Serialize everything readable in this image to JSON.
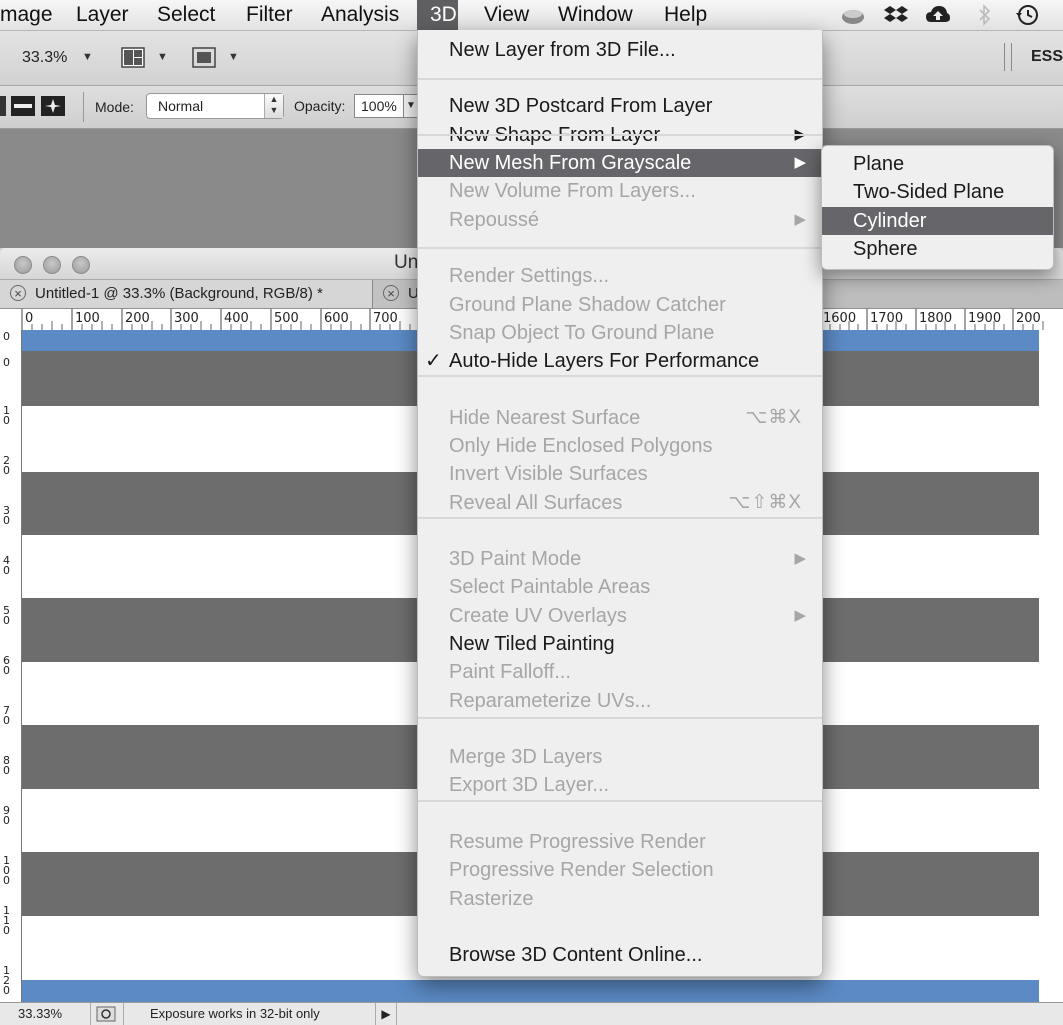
{
  "menubar": {
    "items": [
      "mage",
      "Layer",
      "Select",
      "Filter",
      "Analysis",
      "3D",
      "View",
      "Window",
      "Help"
    ],
    "active": "3D",
    "tray_icons": [
      "cloud-cup-icon",
      "dropbox-icon",
      "cloud-upload-icon",
      "bluetooth-icon",
      "time-machine-icon"
    ]
  },
  "options": {
    "zoom": "33.3%",
    "workspace": "ESSI",
    "mode_label": "Mode:",
    "mode_value": "Normal",
    "opacity_label": "Opacity:",
    "opacity_value": "100%"
  },
  "document": {
    "window_title": "Un",
    "tabs": [
      "Untitled-1 @ 33.3% (Background, RGB/8) *",
      "U"
    ],
    "ruler_h": [
      "0",
      "100",
      "200",
      "300",
      "400",
      "500",
      "600",
      "700",
      "1600",
      "1700",
      "1800",
      "1900",
      "200"
    ],
    "ruler_v": [
      "0",
      "0",
      "10",
      "20",
      "30",
      "40",
      "50",
      "60",
      "70",
      "80",
      "90",
      "100",
      "110",
      "120"
    ],
    "colors": {
      "blue": "#5b8ac4",
      "gray": "#6d6d6d",
      "white": "#ffffff"
    }
  },
  "status": {
    "zoom": "33.33%",
    "message": "Exposure works in 32-bit only"
  },
  "menu3d": {
    "items": [
      {
        "label": "New Layer from 3D File...",
        "enabled": true
      },
      {
        "sep": true
      },
      {
        "label": "New 3D Postcard From Layer",
        "enabled": true
      },
      {
        "label": "New Shape From Layer",
        "enabled": true,
        "submenu": true
      },
      {
        "label": "New Mesh From Grayscale",
        "enabled": true,
        "submenu": true,
        "highlighted": true
      },
      {
        "label": "New Volume From Layers...",
        "enabled": false
      },
      {
        "label": "Repoussé",
        "enabled": false,
        "submenu": true
      },
      {
        "sep": true
      },
      {
        "label": "Render Settings...",
        "enabled": false
      },
      {
        "label": "Ground Plane Shadow Catcher",
        "enabled": false
      },
      {
        "label": "Snap Object To Ground Plane",
        "enabled": false
      },
      {
        "label": "Auto-Hide Layers For Performance",
        "enabled": true,
        "checked": true
      },
      {
        "sep": true
      },
      {
        "label": "Hide Nearest Surface",
        "enabled": false,
        "shortcut": "⌥⌘X"
      },
      {
        "label": "Only Hide Enclosed Polygons",
        "enabled": false
      },
      {
        "label": "Invert Visible Surfaces",
        "enabled": false
      },
      {
        "label": "Reveal All Surfaces",
        "enabled": false,
        "shortcut": "⌥⇧⌘X"
      },
      {
        "sep": true
      },
      {
        "label": "3D Paint Mode",
        "enabled": false,
        "submenu": true
      },
      {
        "label": "Select Paintable Areas",
        "enabled": false
      },
      {
        "label": "Create UV Overlays",
        "enabled": false,
        "submenu": true
      },
      {
        "label": "New Tiled Painting",
        "enabled": true
      },
      {
        "label": "Paint Falloff...",
        "enabled": false
      },
      {
        "label": "Reparameterize UVs...",
        "enabled": false
      },
      {
        "sep": true
      },
      {
        "label": "Merge 3D Layers",
        "enabled": false
      },
      {
        "label": "Export 3D Layer...",
        "enabled": false
      },
      {
        "sep": true
      },
      {
        "label": "Resume Progressive Render",
        "enabled": false
      },
      {
        "label": "Progressive Render Selection",
        "enabled": false
      },
      {
        "label": "Rasterize",
        "enabled": false
      },
      {
        "sep": true
      },
      {
        "label": "Browse 3D Content Online...",
        "enabled": true
      }
    ]
  },
  "submenu": {
    "items": [
      "Plane",
      "Two-Sided Plane",
      "Cylinder",
      "Sphere"
    ],
    "highlighted": "Cylinder"
  }
}
